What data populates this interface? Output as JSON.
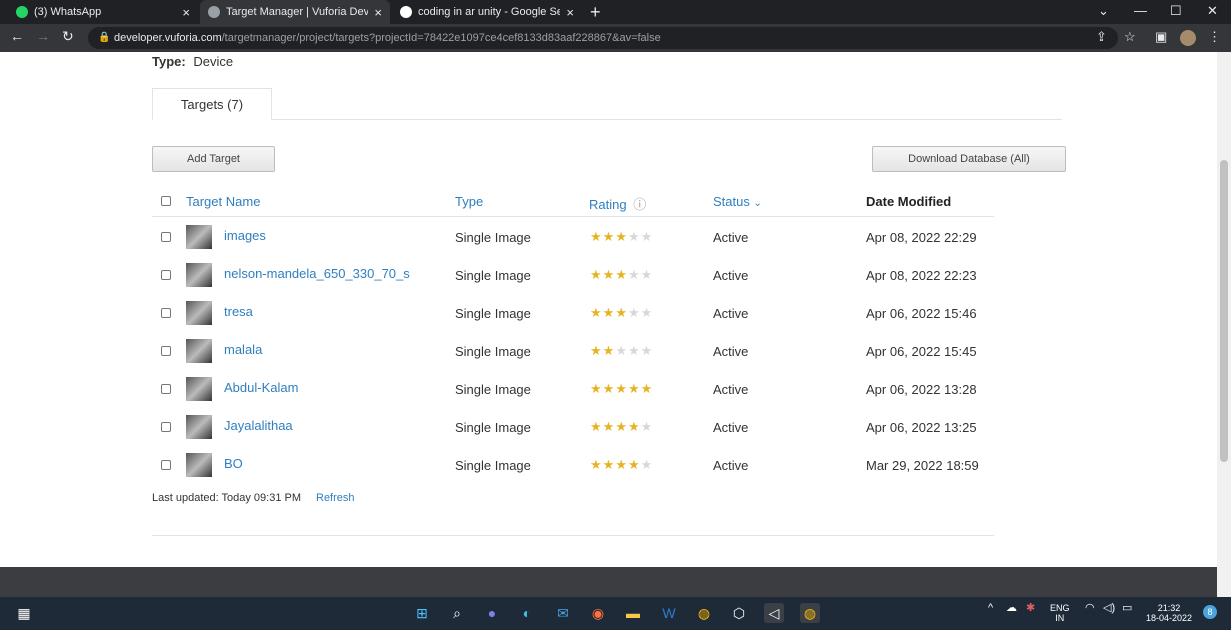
{
  "browser": {
    "tabs": [
      {
        "title": "(3) WhatsApp",
        "close": "×",
        "favicon_color": "#25d366"
      },
      {
        "title": "Target Manager | Vuforia Develo",
        "close": "×",
        "favicon_color": "#9aa0a6"
      },
      {
        "title": "coding in ar unity - Google Searc",
        "close": "×",
        "favicon_color": "#ffffff"
      }
    ],
    "new_tab": "+",
    "window_controls": {
      "chevron": "⌄",
      "minimize": "—",
      "maximize": "☐",
      "close": "✕"
    },
    "url_host": "developer.vuforia.com",
    "url_path": "/targetmanager/project/targets?projectId=78422e1097ce4cef8133d83aaf228867&av=false"
  },
  "page": {
    "type_label": "Type:",
    "type_value": "Device",
    "tab_label": "Targets (7)",
    "add_target": "Add Target",
    "download_database": "Download Database (All)",
    "columns": {
      "name": "Target Name",
      "type": "Type",
      "rating": "Rating",
      "rating_info": "ⓘ",
      "status": "Status",
      "status_sort": "⌄",
      "date": "Date Modified"
    },
    "rows": [
      {
        "name": "images",
        "type": "Single Image",
        "rating": 3,
        "status": "Active",
        "date": "Apr 08, 2022 22:29"
      },
      {
        "name": "nelson-mandela_650_330_70_s",
        "type": "Single Image",
        "rating": 3,
        "status": "Active",
        "date": "Apr 08, 2022 22:23"
      },
      {
        "name": "tresa",
        "type": "Single Image",
        "rating": 3,
        "status": "Active",
        "date": "Apr 06, 2022 15:46"
      },
      {
        "name": "malala",
        "type": "Single Image",
        "rating": 2,
        "status": "Active",
        "date": "Apr 06, 2022 15:45"
      },
      {
        "name": "Abdul-Kalam",
        "type": "Single Image",
        "rating": 5,
        "status": "Active",
        "date": "Apr 06, 2022 13:28"
      },
      {
        "name": "Jayalalithaa",
        "type": "Single Image",
        "rating": 4,
        "status": "Active",
        "date": "Apr 06, 2022 13:25"
      },
      {
        "name": "BO",
        "type": "Single Image",
        "rating": 4,
        "status": "Active",
        "date": "Mar 29, 2022 18:59"
      }
    ],
    "last_updated": "Last updated: Today 09:31 PM",
    "refresh": "Refresh"
  },
  "taskbar": {
    "lang": "ENG",
    "region": "IN",
    "time": "21:32",
    "date": "18-04-2022",
    "notifications": "8"
  },
  "colors": {
    "link": "#2f7fbf",
    "star_on": "#e6b422",
    "star_off": "#d8d8d8",
    "taskbar": "#1f2a38"
  }
}
